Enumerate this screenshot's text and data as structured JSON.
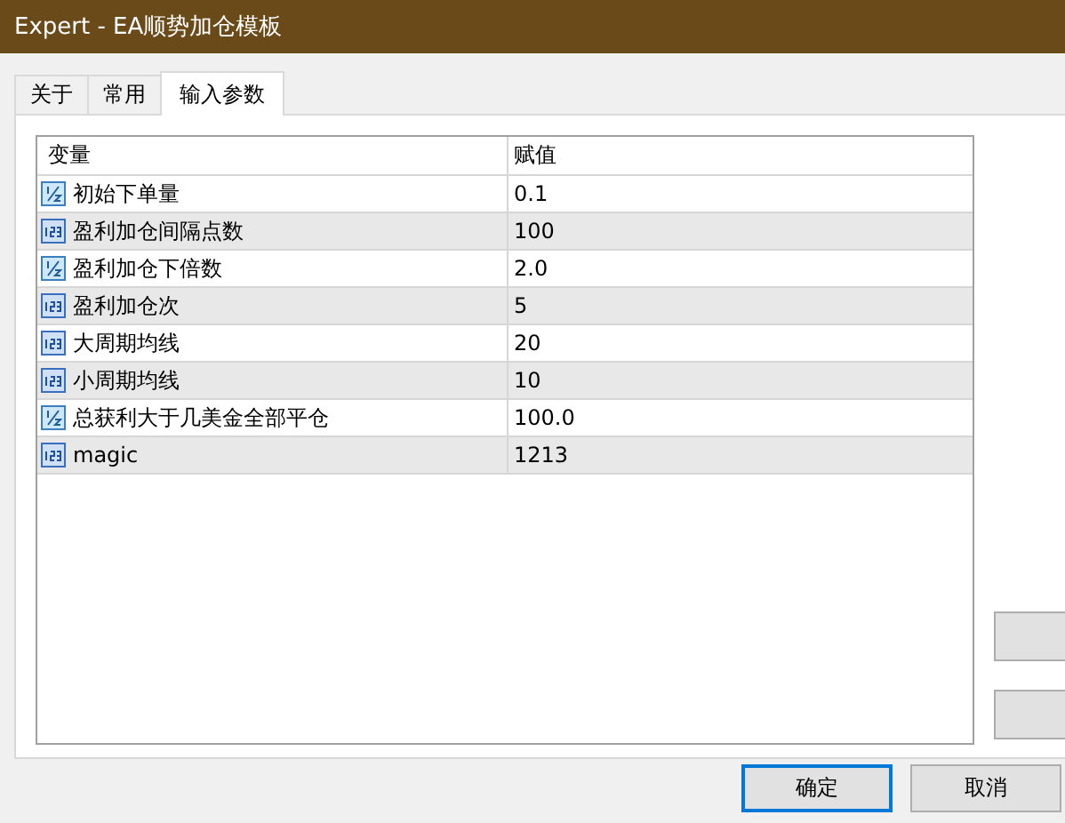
{
  "window": {
    "title": "Expert - EA顺势加仓模板"
  },
  "tabs": [
    {
      "label": "关于",
      "selected": false
    },
    {
      "label": "常用",
      "selected": false
    },
    {
      "label": "输入参数",
      "selected": true
    }
  ],
  "table": {
    "columns": [
      "变量",
      "赋值"
    ],
    "rows": [
      {
        "kind": "double",
        "name": "初始下单量",
        "value": "0.1"
      },
      {
        "kind": "int",
        "name": "盈利加仓间隔点数",
        "value": "100"
      },
      {
        "kind": "double",
        "name": "盈利加仓下倍数",
        "value": "2.0"
      },
      {
        "kind": "int",
        "name": "盈利加仓次",
        "value": "5"
      },
      {
        "kind": "int",
        "name": "大周期均线",
        "value": "20"
      },
      {
        "kind": "int",
        "name": "小周期均线",
        "value": "10"
      },
      {
        "kind": "double",
        "name": "总获利大于几美金全部平仓",
        "value": "100.0"
      },
      {
        "kind": "int",
        "name": "magic",
        "value": "1213"
      }
    ]
  },
  "buttons": [
    {
      "label": "确定",
      "default": true
    },
    {
      "label": "取消",
      "default": false
    }
  ]
}
